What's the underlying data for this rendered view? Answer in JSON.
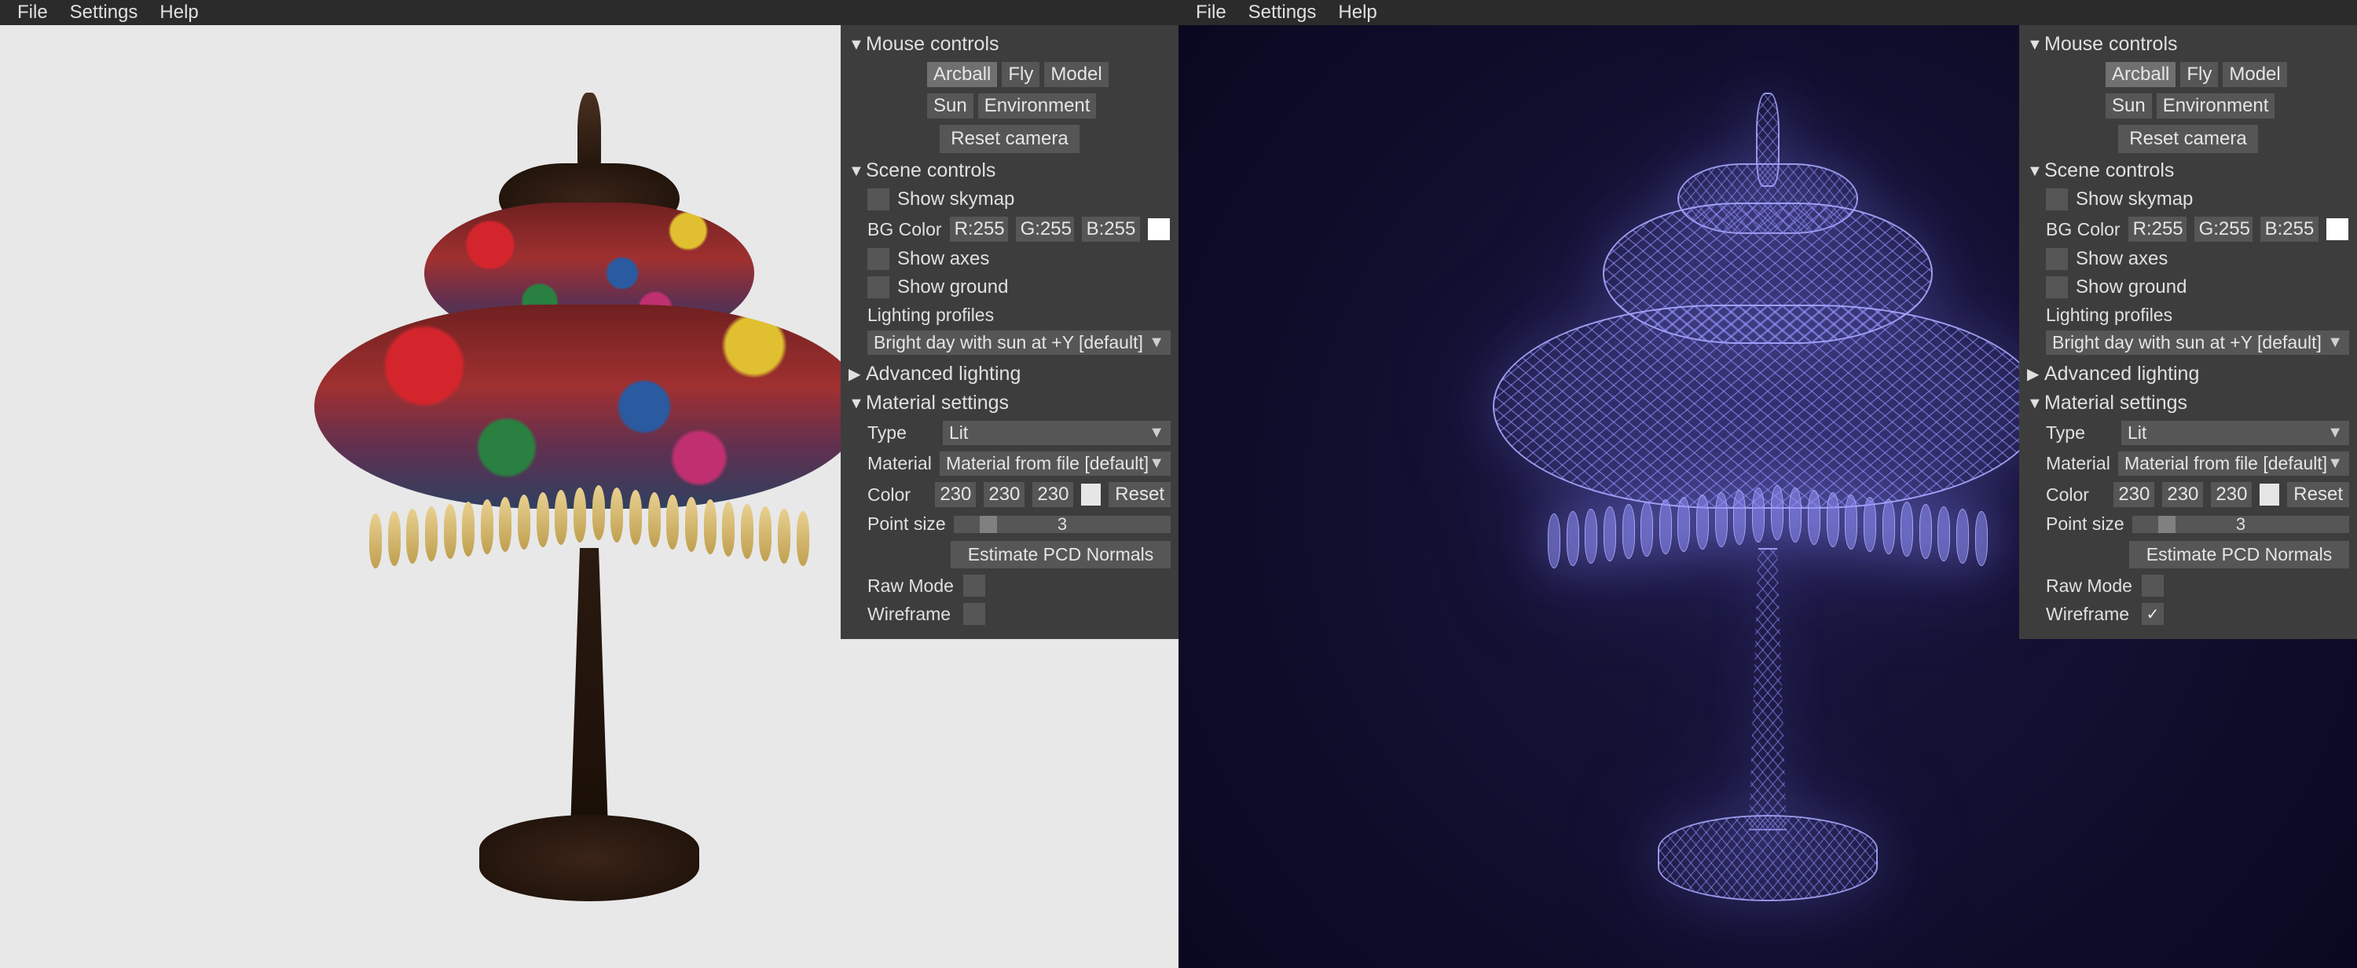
{
  "menu": {
    "file": "File",
    "settings": "Settings",
    "help": "Help"
  },
  "panes": [
    {
      "viewport_bg": "#e8e8e8",
      "render_mode": "lit",
      "mouse": {
        "title": "Mouse controls",
        "modes": [
          "Arcball",
          "Fly",
          "Model"
        ],
        "modes2": [
          "Sun",
          "Environment"
        ],
        "active_mode": "Arcball",
        "reset": "Reset camera"
      },
      "scene": {
        "title": "Scene controls",
        "show_skymap": {
          "label": "Show skymap",
          "checked": false
        },
        "bg_label": "BG Color",
        "bg": {
          "r": "R:255",
          "g": "G:255",
          "b": "B:255",
          "hex": "#ffffff"
        },
        "show_axes": {
          "label": "Show axes",
          "checked": false
        },
        "show_ground": {
          "label": "Show ground",
          "checked": false
        },
        "lighting_label": "Lighting profiles",
        "lighting_value": "Bright day with sun at +Y [default]"
      },
      "advanced": {
        "title": "Advanced lighting",
        "open": false
      },
      "material": {
        "title": "Material settings",
        "type_label": "Type",
        "type_value": "Lit",
        "material_label": "Material",
        "material_value": "Material from file [default]",
        "color_label": "Color",
        "color": {
          "r": "230",
          "g": "230",
          "b": "230",
          "hex": "#e6e6e6"
        },
        "reset": "Reset",
        "point_size_label": "Point size",
        "point_size": "3",
        "estimate": "Estimate PCD Normals",
        "raw_label": "Raw Mode",
        "raw_checked": false,
        "wire_label": "Wireframe",
        "wire_checked": false
      }
    },
    {
      "viewport_bg": "#0a0820",
      "render_mode": "wireframe",
      "mouse": {
        "title": "Mouse controls",
        "modes": [
          "Arcball",
          "Fly",
          "Model"
        ],
        "modes2": [
          "Sun",
          "Environment"
        ],
        "active_mode": "Arcball",
        "reset": "Reset camera"
      },
      "scene": {
        "title": "Scene controls",
        "show_skymap": {
          "label": "Show skymap",
          "checked": false
        },
        "bg_label": "BG Color",
        "bg": {
          "r": "R:255",
          "g": "G:255",
          "b": "B:255",
          "hex": "#ffffff"
        },
        "show_axes": {
          "label": "Show axes",
          "checked": false
        },
        "show_ground": {
          "label": "Show ground",
          "checked": false
        },
        "lighting_label": "Lighting profiles",
        "lighting_value": "Bright day with sun at +Y [default]"
      },
      "advanced": {
        "title": "Advanced lighting",
        "open": false
      },
      "material": {
        "title": "Material settings",
        "type_label": "Type",
        "type_value": "Lit",
        "material_label": "Material",
        "material_value": "Material from file [default]",
        "color_label": "Color",
        "color": {
          "r": "230",
          "g": "230",
          "b": "230",
          "hex": "#e6e6e6"
        },
        "reset": "Reset",
        "point_size_label": "Point size",
        "point_size": "3",
        "estimate": "Estimate PCD Normals",
        "raw_label": "Raw Mode",
        "raw_checked": false,
        "wire_label": "Wireframe",
        "wire_checked": true
      }
    }
  ]
}
